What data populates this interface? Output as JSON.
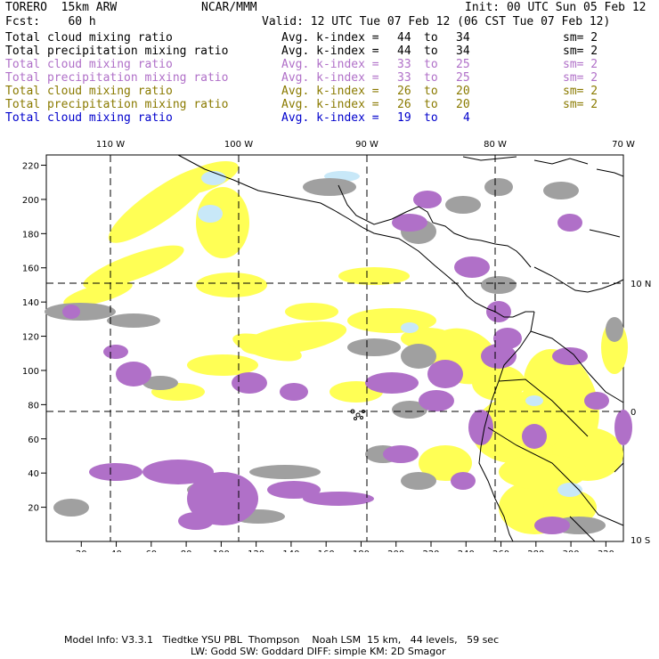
{
  "header": {
    "model": "TORERO  15km ARW",
    "org": "NCAR/MMM",
    "init": "Init: 00 UTC Sun 05 Feb 12",
    "fcst": "Fcst:    60 h",
    "valid": "Valid: 12 UTC Tue 07 Feb 12 (06 CST Tue 07 Feb 12)"
  },
  "legend": [
    {
      "field": "Total cloud mixing ratio",
      "index": "Avg. k-index =",
      "from": "44",
      "to_word": "to",
      "to": "34",
      "sm": "sm= 2",
      "color": "#000000"
    },
    {
      "field": "Total precipitation mixing ratio",
      "index": "Avg. k-index =",
      "from": "44",
      "to_word": "to",
      "to": "34",
      "sm": "sm= 2",
      "color": "#000000"
    },
    {
      "field": "Total cloud mixing ratio",
      "index": "Avg. k-index =",
      "from": "33",
      "to_word": "to",
      "to": "25",
      "sm": "sm= 2",
      "color": "#b070c8"
    },
    {
      "field": "Total precipitation mixing ratio",
      "index": "Avg. k-index =",
      "from": "33",
      "to_word": "to",
      "to": "25",
      "sm": "sm= 2",
      "color": "#b070c8"
    },
    {
      "field": "Total cloud mixing ratio",
      "index": "Avg. k-index =",
      "from": "26",
      "to_word": "to",
      "to": "20",
      "sm": "sm= 2",
      "color": "#8a7a00"
    },
    {
      "field": "Total precipitation mixing ratio",
      "index": "Avg. k-index =",
      "from": "26",
      "to_word": "to",
      "to": "20",
      "sm": "sm= 2",
      "color": "#8a7a00"
    },
    {
      "field": "Total cloud mixing ratio",
      "index": "Avg. k-index =",
      "from": "19",
      "to_word": "to",
      "to": "4",
      "sm": "",
      "color": "#0000cc"
    }
  ],
  "map": {
    "lon_labels": [
      "110 W",
      "100 W",
      "90 W",
      "80 W",
      "70 W"
    ],
    "lat_labels": [
      "10 N",
      "0",
      "10 S"
    ],
    "x_ticks": [
      "20",
      "40",
      "60",
      "80",
      "100",
      "120",
      "140",
      "160",
      "180",
      "200",
      "220",
      "240",
      "260",
      "280",
      "300",
      "320"
    ],
    "y_ticks": [
      "20",
      "40",
      "60",
      "80",
      "100",
      "120",
      "140",
      "160",
      "180",
      "200",
      "220"
    ],
    "colors": {
      "upper_levels": "#a0a0a0",
      "mid_levels": "#b070c8",
      "low_levels": "#ffff55",
      "lowest_levels": "#c8e8f8",
      "coast": "#000000"
    }
  },
  "footer": {
    "line1": "Model Info: V3.3.1   Tiedtke YSU PBL  Thompson    Noah LSM  15 km,   44 levels,   59 sec",
    "line2": "LW: Godd SW: Goddard DIFF: simple KM: 2D Smagor"
  }
}
